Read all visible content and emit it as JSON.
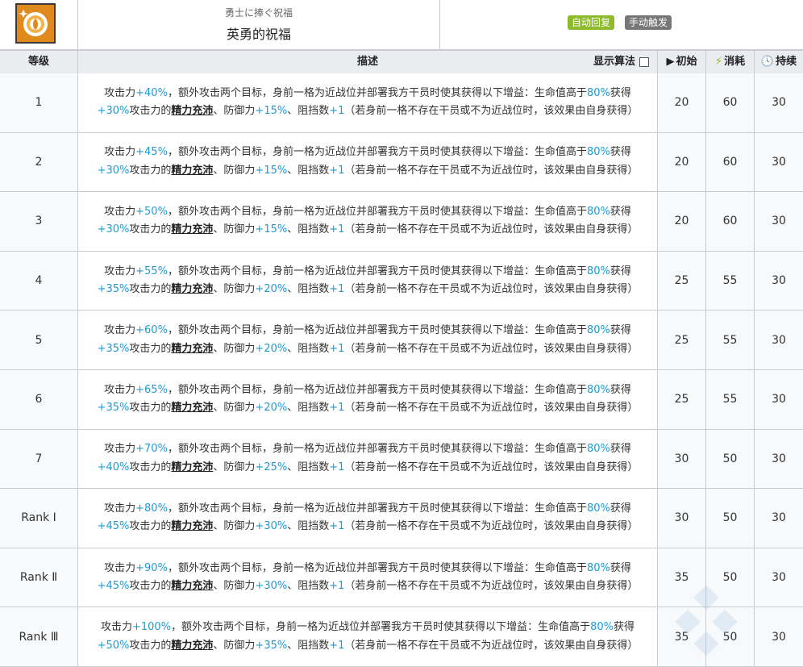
{
  "header": {
    "skill_name_jp": "勇士に捧ぐ祝福",
    "skill_name_cn": "英勇的祝福",
    "tags": {
      "auto_recovery": "自动回复",
      "manual_trigger": "手动触发"
    },
    "icon": "rose-emblem-icon",
    "colors": {
      "auto_tag": "#8dbb2b",
      "manual_tag": "#777777",
      "icon_bg": "#e08a1e",
      "highlight": "#1b9bd6"
    }
  },
  "columns": {
    "level": "等级",
    "description": "描述",
    "show_formula": "显示算法",
    "initial": "初始",
    "cost": "消耗",
    "duration": "持续"
  },
  "description_parts": {
    "p1": "攻击力",
    "p2": "，额外攻击两个目标，身前一格为近战位并部署我方干员时使其获得以下增益：生命值高于",
    "hp_threshold": "80%",
    "p3": "获得",
    "p4": "攻击力的",
    "term": "精力充沛",
    "p5": "、防御力",
    "p6": "、阻挡数",
    "block": "+1",
    "p7": "（若身前一格不存在干员或不为近战位时，该效果由自身获得）"
  },
  "levels": [
    {
      "level": "1",
      "atk": "+40%",
      "vigor": "+30%",
      "def": "+15%",
      "initial": "20",
      "cost": "60",
      "duration": "30"
    },
    {
      "level": "2",
      "atk": "+45%",
      "vigor": "+30%",
      "def": "+15%",
      "initial": "20",
      "cost": "60",
      "duration": "30"
    },
    {
      "level": "3",
      "atk": "+50%",
      "vigor": "+30%",
      "def": "+15%",
      "initial": "20",
      "cost": "60",
      "duration": "30"
    },
    {
      "level": "4",
      "atk": "+55%",
      "vigor": "+35%",
      "def": "+20%",
      "initial": "25",
      "cost": "55",
      "duration": "30"
    },
    {
      "level": "5",
      "atk": "+60%",
      "vigor": "+35%",
      "def": "+20%",
      "initial": "25",
      "cost": "55",
      "duration": "30"
    },
    {
      "level": "6",
      "atk": "+65%",
      "vigor": "+35%",
      "def": "+20%",
      "initial": "25",
      "cost": "55",
      "duration": "30"
    },
    {
      "level": "7",
      "atk": "+70%",
      "vigor": "+40%",
      "def": "+25%",
      "initial": "30",
      "cost": "50",
      "duration": "30"
    },
    {
      "level": "Rank Ⅰ",
      "atk": "+80%",
      "vigor": "+45%",
      "def": "+30%",
      "initial": "30",
      "cost": "50",
      "duration": "30"
    },
    {
      "level": "Rank Ⅱ",
      "atk": "+90%",
      "vigor": "+45%",
      "def": "+30%",
      "initial": "35",
      "cost": "50",
      "duration": "30"
    },
    {
      "level": "Rank Ⅲ",
      "atk": "+100%",
      "vigor": "+50%",
      "def": "+35%",
      "initial": "35",
      "cost": "50",
      "duration": "30"
    }
  ]
}
